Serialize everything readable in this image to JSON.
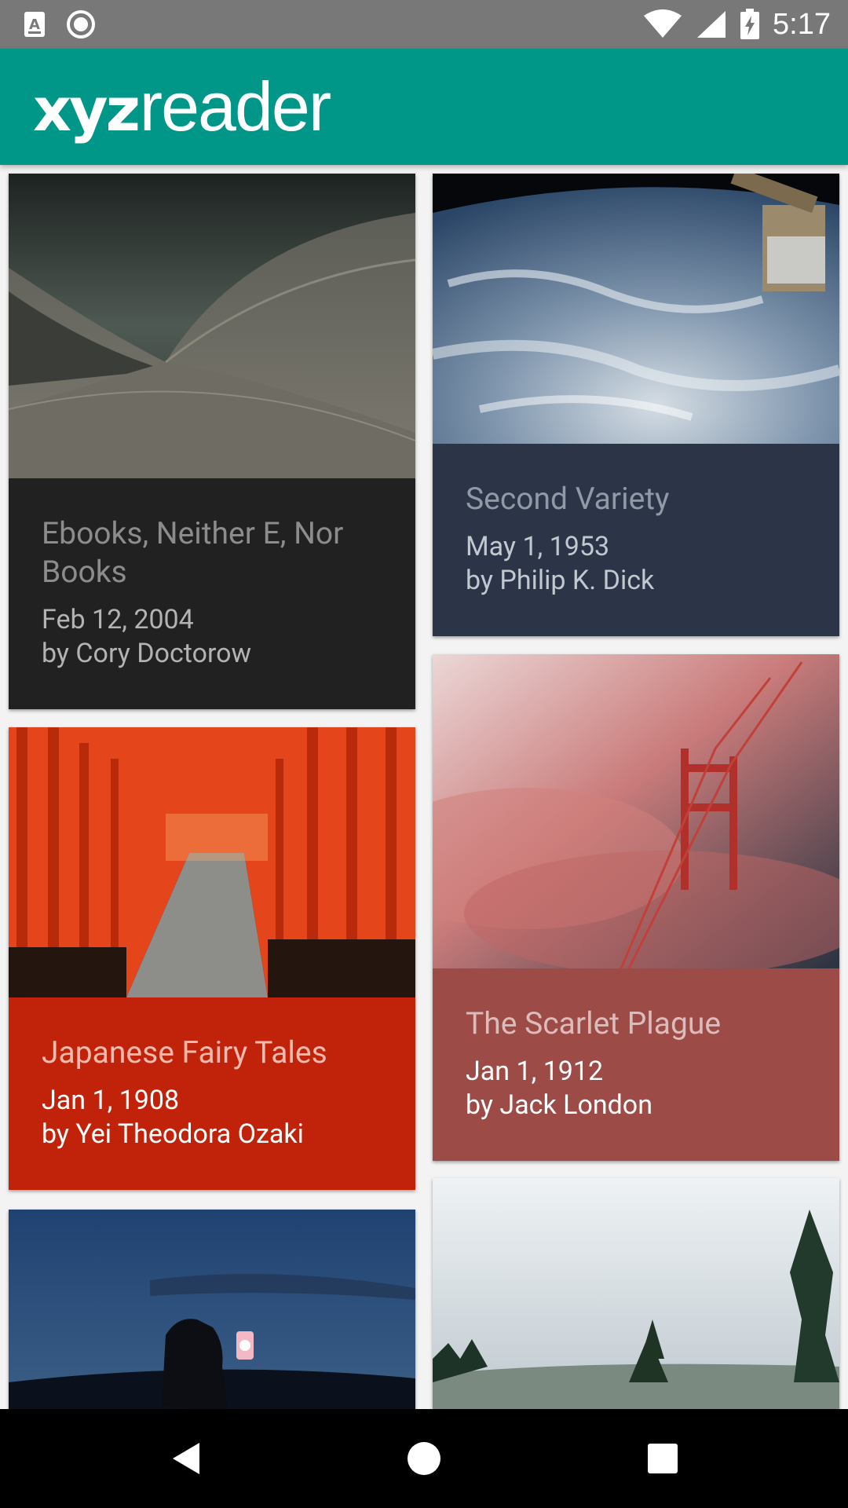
{
  "status_bar": {
    "time": "5:17",
    "icons": [
      "a-notification-icon",
      "circle-notification-icon",
      "wifi-icon",
      "cell-signal-icon",
      "battery-charging-icon"
    ]
  },
  "app": {
    "title_bold": "xyz",
    "title_light": "reader",
    "primary_color": "#009688"
  },
  "articles": [
    {
      "title": "Ebooks, Neither E, Nor Books",
      "date": "Feb 12, 2004",
      "author": "by Cory Doctorow",
      "meta_color": "#212121",
      "image": "opera-house-roof"
    },
    {
      "title": "Second Variety",
      "date": "May 1, 1953",
      "author": "by Philip K. Dick",
      "meta_color": "#2b3547",
      "image": "earth-from-orbit"
    },
    {
      "title": "Japanese Fairy Tales",
      "date": "Jan 1, 1908",
      "author": "by Yei Theodora Ozaki",
      "meta_color": "#c0230a",
      "image": "torii-gates"
    },
    {
      "title": "The Scarlet Plague",
      "date": "Jan 1, 1912",
      "author": "by Jack London",
      "meta_color": "#9c4b47",
      "image": "bridge-in-fog"
    },
    {
      "title": "",
      "date": "",
      "author": "",
      "meta_color": "#27466e",
      "image": "lantern-silhouette"
    },
    {
      "title": "",
      "date": "",
      "author": "",
      "meta_color": "#8a9aa3",
      "image": "forest-landscape"
    }
  ],
  "nav_bar": {
    "back": "back-icon",
    "home": "home-icon",
    "recents": "recents-icon"
  }
}
